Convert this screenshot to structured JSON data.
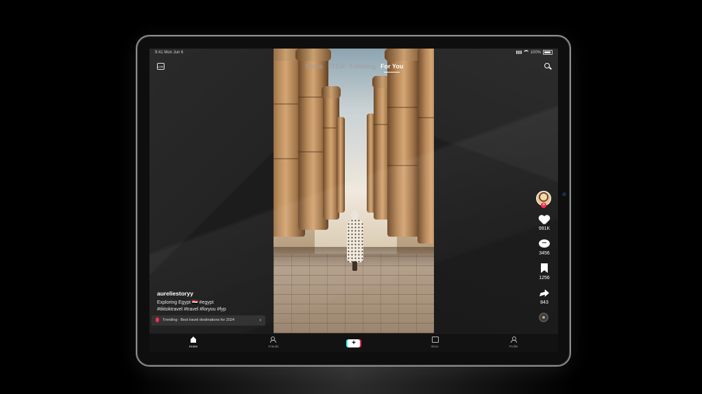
{
  "status_bar": {
    "time": "9:41",
    "date": "Mon Jun 6",
    "battery": "100%"
  },
  "top_nav": {
    "live_label": "LIVE",
    "tabs": [
      {
        "label": "Sports",
        "active": false
      },
      {
        "label": "STEM",
        "active": false
      },
      {
        "label": "Following",
        "active": false
      },
      {
        "label": "For You",
        "active": true
      }
    ]
  },
  "post": {
    "username": "aureliestoryy",
    "caption_line1": "Exploring Egypt 🇪🇬 #egypt",
    "caption_line2": "#tiktoktravel #travel #foryou #fyp",
    "trending": "Trending · Best travel destinations for 2024"
  },
  "actions": {
    "likes": "991K",
    "comments": "3456",
    "saves": "1256",
    "shares": "843"
  },
  "bottom_nav": [
    {
      "label": "Home",
      "icon": "home-icon",
      "active": true
    },
    {
      "label": "Friends",
      "icon": "friends-icon",
      "active": false
    },
    {
      "label": "+",
      "icon": "create-icon",
      "active": false
    },
    {
      "label": "Inbox",
      "icon": "inbox-icon",
      "active": false
    },
    {
      "label": "Profile",
      "icon": "profile-icon",
      "active": false
    }
  ],
  "colors": {
    "accent": "#fe2c55",
    "cyan": "#25f4ee",
    "background": "#202020"
  }
}
